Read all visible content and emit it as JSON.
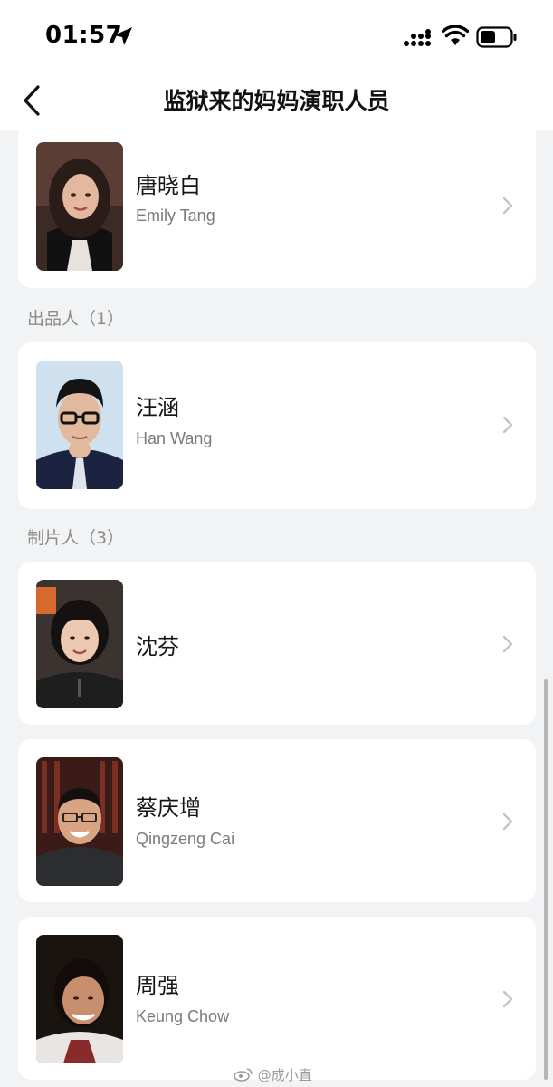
{
  "status_bar": {
    "time": "01:57"
  },
  "nav": {
    "title": "监狱来的妈妈演职人员"
  },
  "sections": [
    {
      "label": "出品人（1）"
    },
    {
      "label": "制片人（3）"
    }
  ],
  "people": [
    {
      "name_cn": "唐晓白",
      "name_en": "Emily Tang"
    },
    {
      "name_cn": "汪涵",
      "name_en": "Han Wang"
    },
    {
      "name_cn": "沈芬",
      "name_en": ""
    },
    {
      "name_cn": "蔡庆增",
      "name_en": "Qingzeng Cai"
    },
    {
      "name_cn": "周强",
      "name_en": "Keung Chow"
    }
  ],
  "watermark": "@成小直",
  "icons": {
    "back": "back-icon",
    "location": "location-arrow-icon",
    "signal": "cellular-signal-icon",
    "wifi": "wifi-icon",
    "battery": "battery-icon",
    "chevron": "chevron-right-icon"
  },
  "colors": {
    "background": "#f2f3f5",
    "card": "#ffffff",
    "secondary_text": "#7b7b7b",
    "section_label": "#8c8c8c"
  }
}
